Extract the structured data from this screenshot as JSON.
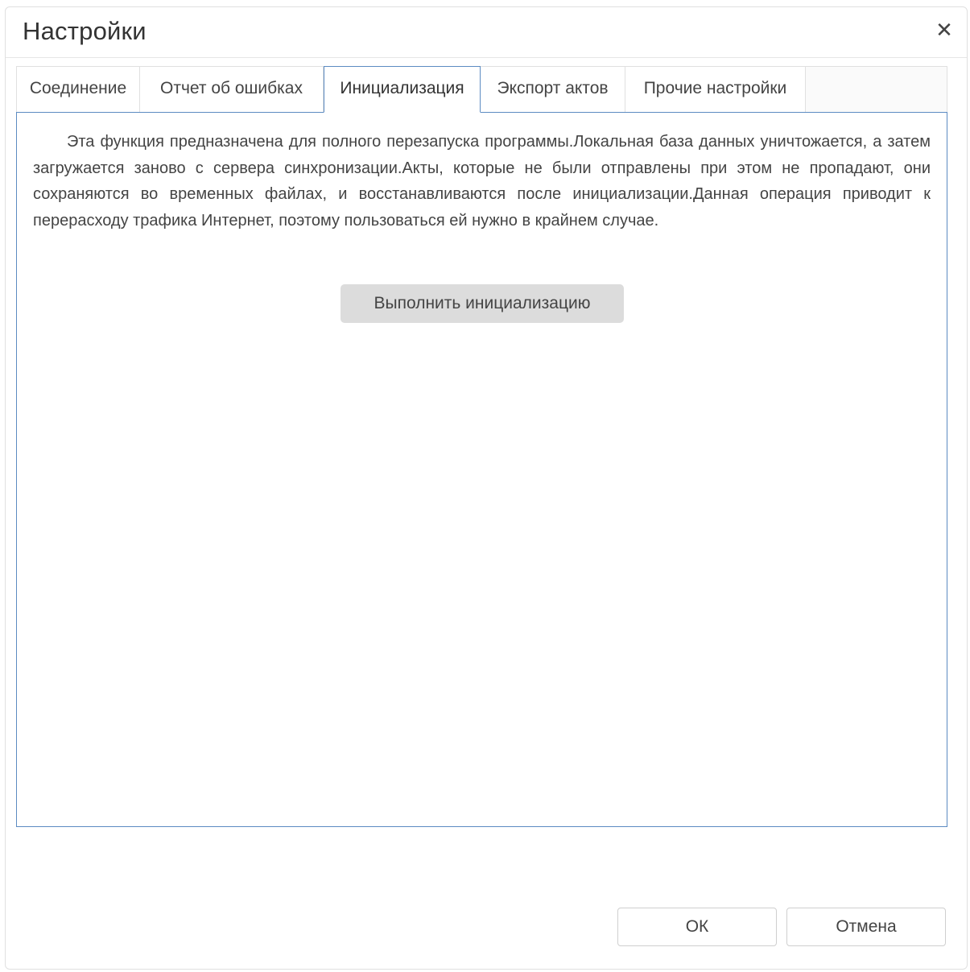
{
  "dialog": {
    "title": "Настройки",
    "close_label": "✕"
  },
  "tabs": [
    {
      "label": "Соединение",
      "active": false
    },
    {
      "label": "Отчет об ошибках",
      "active": false
    },
    {
      "label": "Инициализация",
      "active": true
    },
    {
      "label": "Экспорт актов",
      "active": false
    },
    {
      "label": "Прочие настройки",
      "active": false
    }
  ],
  "initialization": {
    "description": "Эта функция предназначена для полного перезапуска программы.Локальная база данных уничтожается, а затем загружается заново с сервера синхронизации.Акты, которые не были отправлены при этом не пропадают, они сохраняются во временных файлах, и восстанавливаются после инициализации.Данная операция приводит к перерасходу трафика Интернет, поэтому пользоваться ей нужно в крайнем случае.",
    "run_button_label": "Выполнить инициализацию"
  },
  "footer": {
    "ok_label": "ОК",
    "cancel_label": "Отмена"
  },
  "colors": {
    "active_border": "#5c8bc2",
    "button_gray": "#dcdcdc"
  }
}
